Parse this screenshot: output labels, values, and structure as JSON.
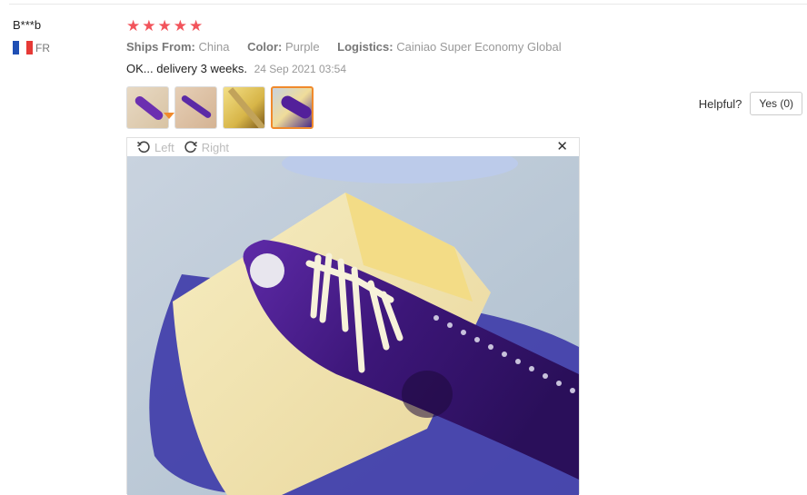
{
  "user": {
    "name": "B***b",
    "country_code": "FR",
    "flag": "france-flag"
  },
  "review": {
    "stars": 5,
    "star_color": "#f2545b",
    "ships_from_label": "Ships From:",
    "ships_from_value": "China",
    "color_label": "Color:",
    "color_value": "Purple",
    "logistics_label": "Logistics:",
    "logistics_value": "Cainiao Super Economy Global",
    "comment": "OK... delivery 3 weeks.",
    "date": "24 Sep 2021 03:54"
  },
  "thumbnails": [
    {
      "name": "thumbnail-1",
      "active": false
    },
    {
      "name": "thumbnail-2",
      "active": false
    },
    {
      "name": "thumbnail-3",
      "active": false
    },
    {
      "name": "thumbnail-4",
      "active": true
    }
  ],
  "helpful": {
    "label": "Helpful?",
    "yes_label": "Yes (0)"
  },
  "viewer": {
    "rotate_left_label": "Left",
    "rotate_right_label": "Right",
    "close_glyph": "✕",
    "image_icon": "butter-knife-photo"
  },
  "colors": {
    "accent": "#f08a2c",
    "knife": "#4a1f8c",
    "butter": "#f3e6b0"
  }
}
